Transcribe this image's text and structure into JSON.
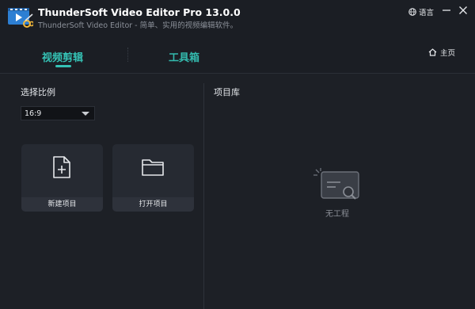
{
  "titlebar": {
    "title": "ThunderSoft Video Editor Pro 13.0.0",
    "subtitle": "ThunderSoft Video Editor - 简单、实用的视频编辑软件。",
    "language_label": "语言"
  },
  "tabs": [
    {
      "label": "视频剪辑",
      "active": true
    },
    {
      "label": "工具箱",
      "active": false
    }
  ],
  "home_label": "主页",
  "left": {
    "ratio_label": "选择比例",
    "ratio_value": "16:9",
    "new_project_label": "新建项目",
    "open_project_label": "打开项目"
  },
  "right": {
    "library_label": "项目库",
    "empty_label": "无工程"
  },
  "colors": {
    "accent": "#35c2b5",
    "background": "#1d2026",
    "card": "#262a32"
  }
}
